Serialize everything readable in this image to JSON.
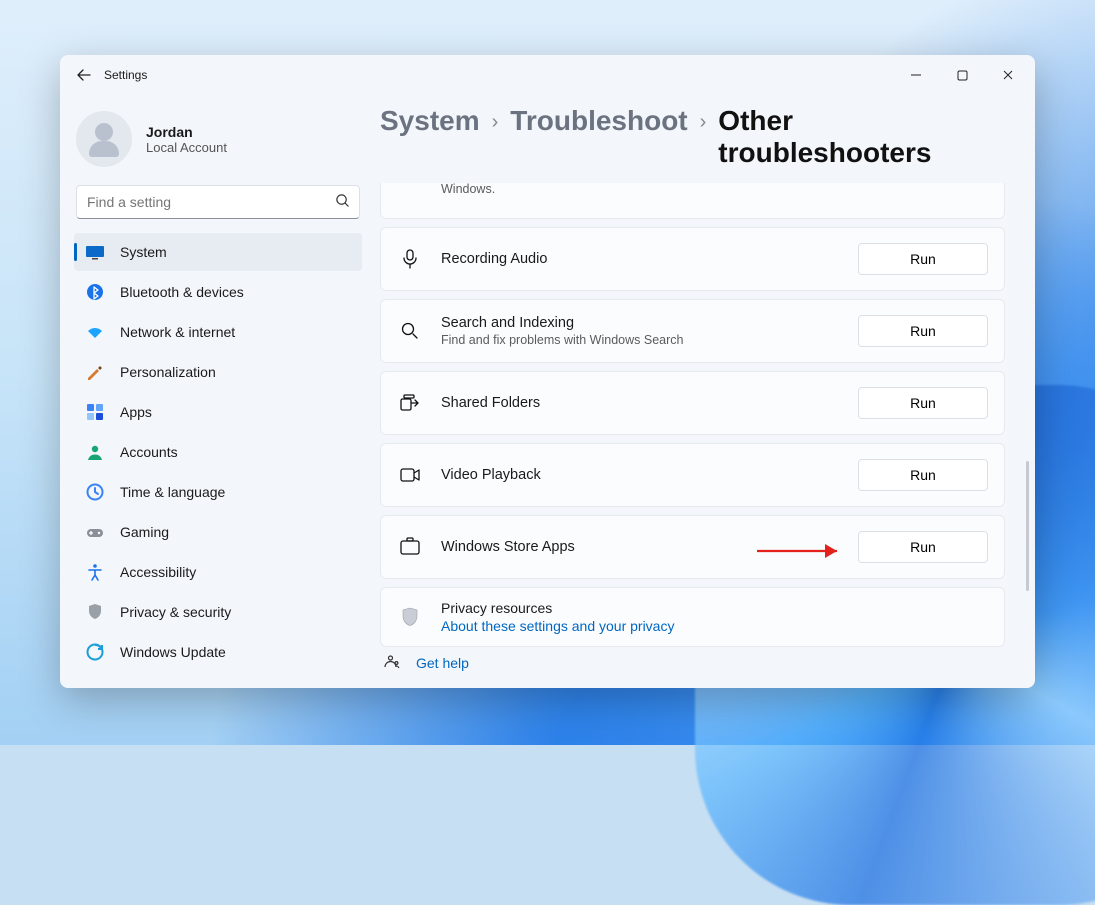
{
  "window": {
    "title": "Settings"
  },
  "user": {
    "name": "Jordan",
    "subtitle": "Local Account"
  },
  "search": {
    "placeholder": "Find a setting"
  },
  "sidebar": {
    "items": [
      {
        "label": "System",
        "icon": "system",
        "active": true
      },
      {
        "label": "Bluetooth & devices",
        "icon": "bluetooth",
        "active": false
      },
      {
        "label": "Network & internet",
        "icon": "wifi",
        "active": false
      },
      {
        "label": "Personalization",
        "icon": "personalization",
        "active": false
      },
      {
        "label": "Apps",
        "icon": "apps",
        "active": false
      },
      {
        "label": "Accounts",
        "icon": "accounts",
        "active": false
      },
      {
        "label": "Time & language",
        "icon": "time",
        "active": false
      },
      {
        "label": "Gaming",
        "icon": "gaming",
        "active": false
      },
      {
        "label": "Accessibility",
        "icon": "accessibility",
        "active": false
      },
      {
        "label": "Privacy & security",
        "icon": "privacy",
        "active": false
      },
      {
        "label": "Windows Update",
        "icon": "update",
        "active": false
      }
    ]
  },
  "breadcrumb": {
    "a": "System",
    "b": "Troubleshoot",
    "c": "Other troubleshooters"
  },
  "truncated_card": {
    "tail": "Windows."
  },
  "troubleshooters": [
    {
      "title": "Recording Audio",
      "sub": "",
      "icon": "mic",
      "run": "Run"
    },
    {
      "title": "Search and Indexing",
      "sub": "Find and fix problems with Windows Search",
      "icon": "search",
      "run": "Run"
    },
    {
      "title": "Shared Folders",
      "sub": "",
      "icon": "shared",
      "run": "Run"
    },
    {
      "title": "Video Playback",
      "sub": "",
      "icon": "video",
      "run": "Run"
    },
    {
      "title": "Windows Store Apps",
      "sub": "",
      "icon": "store",
      "run": "Run"
    }
  ],
  "privacy": {
    "title": "Privacy resources",
    "link": "About these settings and your privacy"
  },
  "help": {
    "label": "Get help"
  },
  "callout": {
    "target_index": 4
  }
}
